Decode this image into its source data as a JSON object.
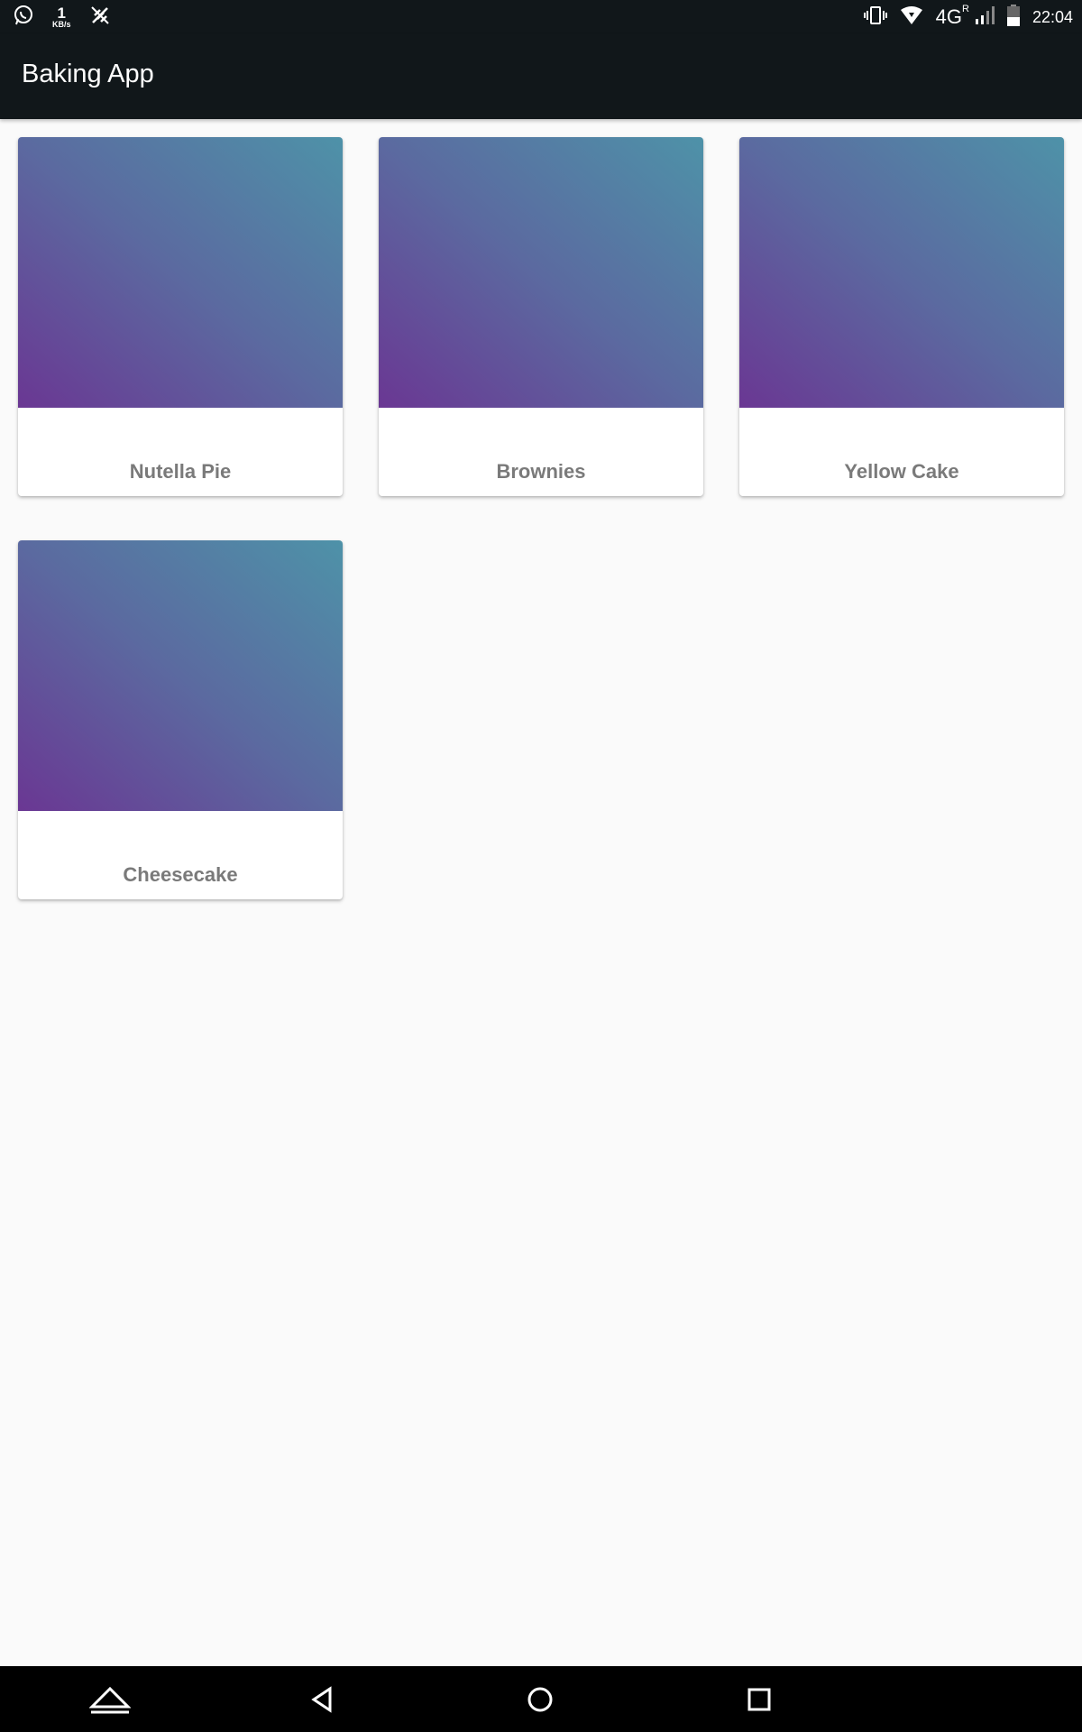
{
  "status_bar": {
    "speed_value": "1",
    "speed_unit": "KB/s",
    "network": "4G",
    "roaming": "R",
    "time": "22:04",
    "icons": [
      "whatsapp-icon",
      "data-speed-indicator",
      "signal-off-icon",
      "vibrate-icon",
      "wifi-icon",
      "4g-icon",
      "cell-signal-icon",
      "battery-icon"
    ]
  },
  "app_bar": {
    "title": "Baking App"
  },
  "recipes": [
    {
      "name": "Nutella Pie"
    },
    {
      "name": "Brownies"
    },
    {
      "name": "Yellow Cake"
    },
    {
      "name": "Cheesecake"
    }
  ],
  "nav_bar": {
    "icons": [
      "home-up-icon",
      "back-icon",
      "home-icon",
      "recents-icon"
    ]
  },
  "colors": {
    "app_bar": "#11171a",
    "background": "#fafafa",
    "gradient_start": "#6a3793",
    "gradient_end": "#4e92a8",
    "card_title": "#7a7a7a"
  }
}
